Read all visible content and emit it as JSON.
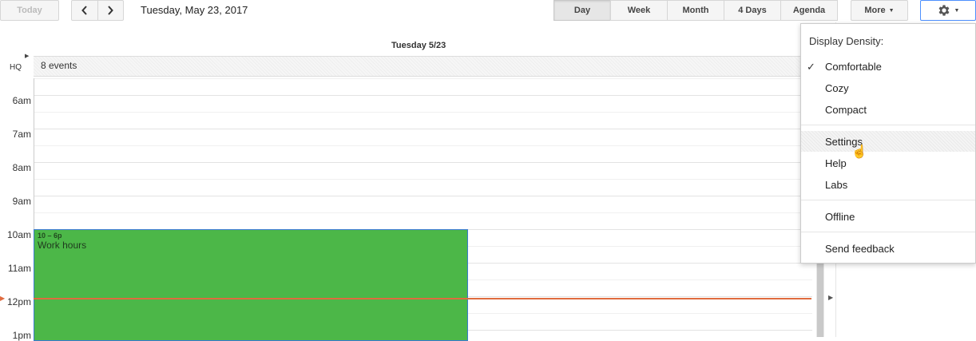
{
  "toolbar": {
    "today_label": "Today",
    "prev_icon": "chevron-left-icon",
    "next_icon": "chevron-right-icon",
    "date": "Tuesday, May 23, 2017",
    "views": [
      "Day",
      "Week",
      "Month",
      "4 Days",
      "Agenda"
    ],
    "selected_view": "Day",
    "more_label": "More",
    "settings_icon": "gear-icon"
  },
  "calendar": {
    "day_header": "Tuesday 5/23",
    "timezone": "HQ",
    "allday_summary": "8 events",
    "hours": [
      "6am",
      "7am",
      "8am",
      "9am",
      "10am",
      "11am",
      "12pm",
      "1pm"
    ],
    "event": {
      "time": "10 – 6p",
      "title": "Work hours",
      "color": "#4cb748"
    },
    "now_line_color": "#e06b3f"
  },
  "menu": {
    "title": "Display Density:",
    "density_options": [
      "Comfortable",
      "Cozy",
      "Compact"
    ],
    "selected_density": "Comfortable",
    "items": [
      "Settings",
      "Help",
      "Labs"
    ],
    "offline": "Offline",
    "feedback": "Send feedback",
    "hovered": "Settings"
  }
}
